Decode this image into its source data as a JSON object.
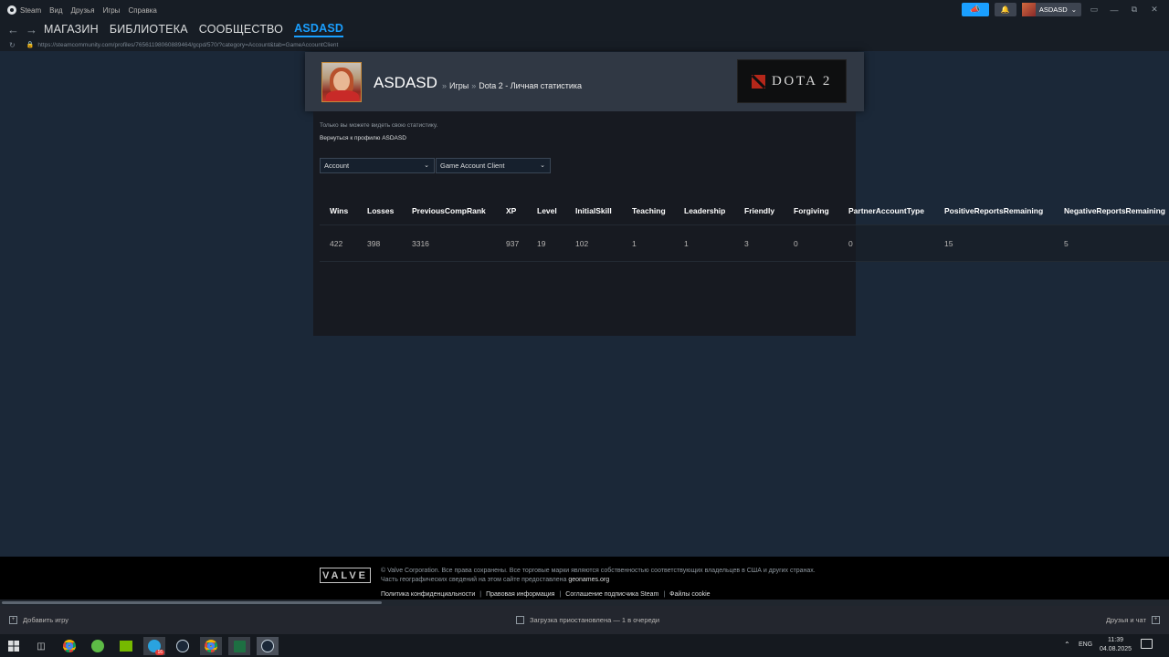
{
  "menubar": {
    "app": "Steam",
    "items": [
      "Вид",
      "Друзья",
      "Игры",
      "Справка"
    ],
    "account_name": "ASDASD"
  },
  "nav": {
    "tabs": [
      "МАГАЗИН",
      "БИБЛИОТЕКА",
      "СООБЩЕСТВО",
      "ASDASD"
    ],
    "active_tab": "ASDASD",
    "url": "https://steamcommunity.com/profiles/76561198060889464/gcpd/570/?category=Account&tab=GameAccountClient"
  },
  "profile": {
    "persona_name": "ASDASD",
    "crumb_sep": "»",
    "crumb_games": "Игры",
    "crumb_page": "Dota 2 - Личная статистика",
    "game_logo_text": "DOTA 2"
  },
  "content": {
    "privacy_note": "Только вы можете видеть свою статистику.",
    "back_link": "Вернуться к профилю ASDASD",
    "category_select": "Account",
    "tab_select": "Game Account Client"
  },
  "stats": {
    "columns": [
      "Wins",
      "Losses",
      "PreviousCompRank",
      "XP",
      "Level",
      "InitialSkill",
      "Teaching",
      "Leadership",
      "Friendly",
      "Forgiving",
      "PartnerAccountType",
      "PositiveReportsRemaining",
      "NegativeReportsRemaining"
    ],
    "values": [
      "422",
      "398",
      "3316",
      "937",
      "19",
      "102",
      "1",
      "1",
      "3",
      "0",
      "0",
      "15",
      "5"
    ]
  },
  "footer": {
    "valve_logo": "VALVE",
    "copyright_line1": "© Valve Corporation. Все права сохранены. Все торговые марки являются собственностью соответствующих владельцев в США и других странах.",
    "copyright_line2_prefix": "Часть географических сведений на этом сайте предоставлена",
    "copyright_line2_link": "geonames.org",
    "links": [
      "Политика конфиденциальности",
      "Правовая информация",
      "Соглашение подписчика Steam",
      "Файлы cookie"
    ],
    "link_divider": "|"
  },
  "statusbar": {
    "add_game": "Добавить игру",
    "downloads": "Загрузка приостановлена — 1 в очереди",
    "friends": "Друзья и чат"
  },
  "taskbar": {
    "lang": "ENG",
    "time": "11:39",
    "date": "04.08.2025",
    "telegram_badge": "16"
  },
  "colors": {
    "accent": "#1a9fff",
    "background": "#1b2838",
    "panel": "#171a21"
  }
}
